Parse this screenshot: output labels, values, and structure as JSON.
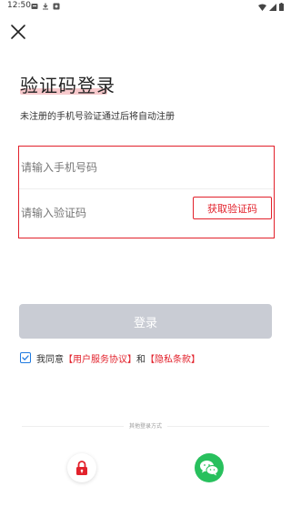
{
  "status_bar": {
    "time": "12:50",
    "left_icons": [
      "notification-icon",
      "download-icon",
      "app-icon"
    ],
    "right_icons": [
      "wifi-icon",
      "signal-icon",
      "battery-icon"
    ]
  },
  "header": {
    "close_icon": "close-icon"
  },
  "login": {
    "title": "验证码登录",
    "subtitle": "未注册的手机号验证通过后将自动注册",
    "phone_placeholder": "请输入手机号码",
    "code_placeholder": "请输入验证码",
    "get_code_label": "获取验证码",
    "submit_label": "登录"
  },
  "agreement": {
    "checked": true,
    "prefix": "我同意",
    "user_agreement": "【用户服务协议】",
    "and": "和",
    "privacy_policy": "【隐私条款】"
  },
  "other_login": {
    "label": "其他登录方式",
    "options": [
      {
        "name": "lock-icon",
        "color": "#e2212b"
      },
      {
        "name": "wechat-icon",
        "color": "#28c05d"
      }
    ]
  },
  "colors": {
    "accent": "#e2212b",
    "disabled_button": "#c9ccd4",
    "checkbox": "#1f7ae0",
    "wechat": "#28c05d"
  }
}
